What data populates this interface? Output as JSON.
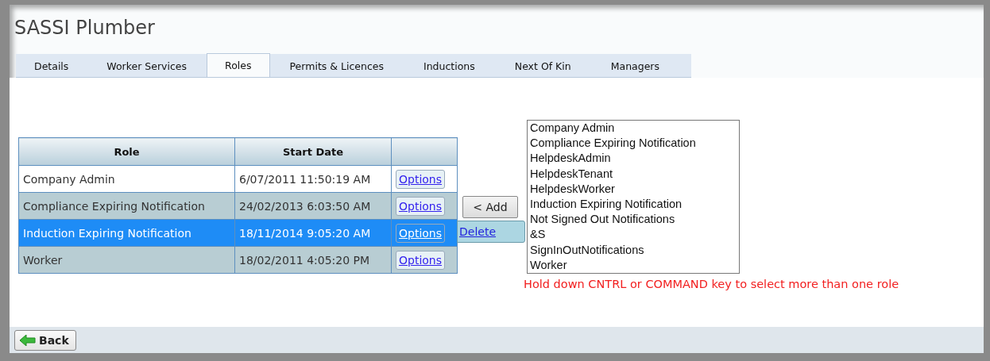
{
  "window": {
    "title": "SASSI Plumber"
  },
  "tabs": [
    {
      "label": "Details",
      "selected": false
    },
    {
      "label": "Worker Services",
      "selected": false
    },
    {
      "label": "Roles",
      "selected": true
    },
    {
      "label": "Permits & Licences",
      "selected": false
    },
    {
      "label": "Inductions",
      "selected": false
    },
    {
      "label": "Next Of Kin",
      "selected": false
    },
    {
      "label": "Managers",
      "selected": false
    }
  ],
  "table": {
    "columns": [
      "Role",
      "Start Date"
    ],
    "rows": [
      {
        "role": "Company Admin",
        "start_date": "6/07/2011 11:50:19 AM",
        "action": "Options",
        "selected": false
      },
      {
        "role": "Compliance Expiring Notification",
        "start_date": "24/02/2013 6:03:50 AM",
        "action": "Options",
        "selected": false
      },
      {
        "role": "Induction Expiring Notification",
        "start_date": "18/11/2014 9:05:20 AM",
        "action": "Options",
        "selected": true,
        "menu": {
          "items": [
            "Delete"
          ]
        }
      },
      {
        "role": "Worker",
        "start_date": "18/02/2011 4:05:20 PM",
        "action": "Options",
        "selected": false
      }
    ]
  },
  "add_button": "< Add",
  "role_list": {
    "items": [
      "Company Admin",
      "Compliance Expiring Notification",
      "HelpdeskAdmin",
      "HelpdeskTenant",
      "HelpdeskWorker",
      "Induction Expiring Notification",
      "Not Signed Out Notifications",
      "&S",
      "SignInOutNotifications",
      "Worker"
    ]
  },
  "hint": "Hold down CNTRL or COMMAND key to select more than one role",
  "footer": {
    "back_button": "Back"
  }
}
